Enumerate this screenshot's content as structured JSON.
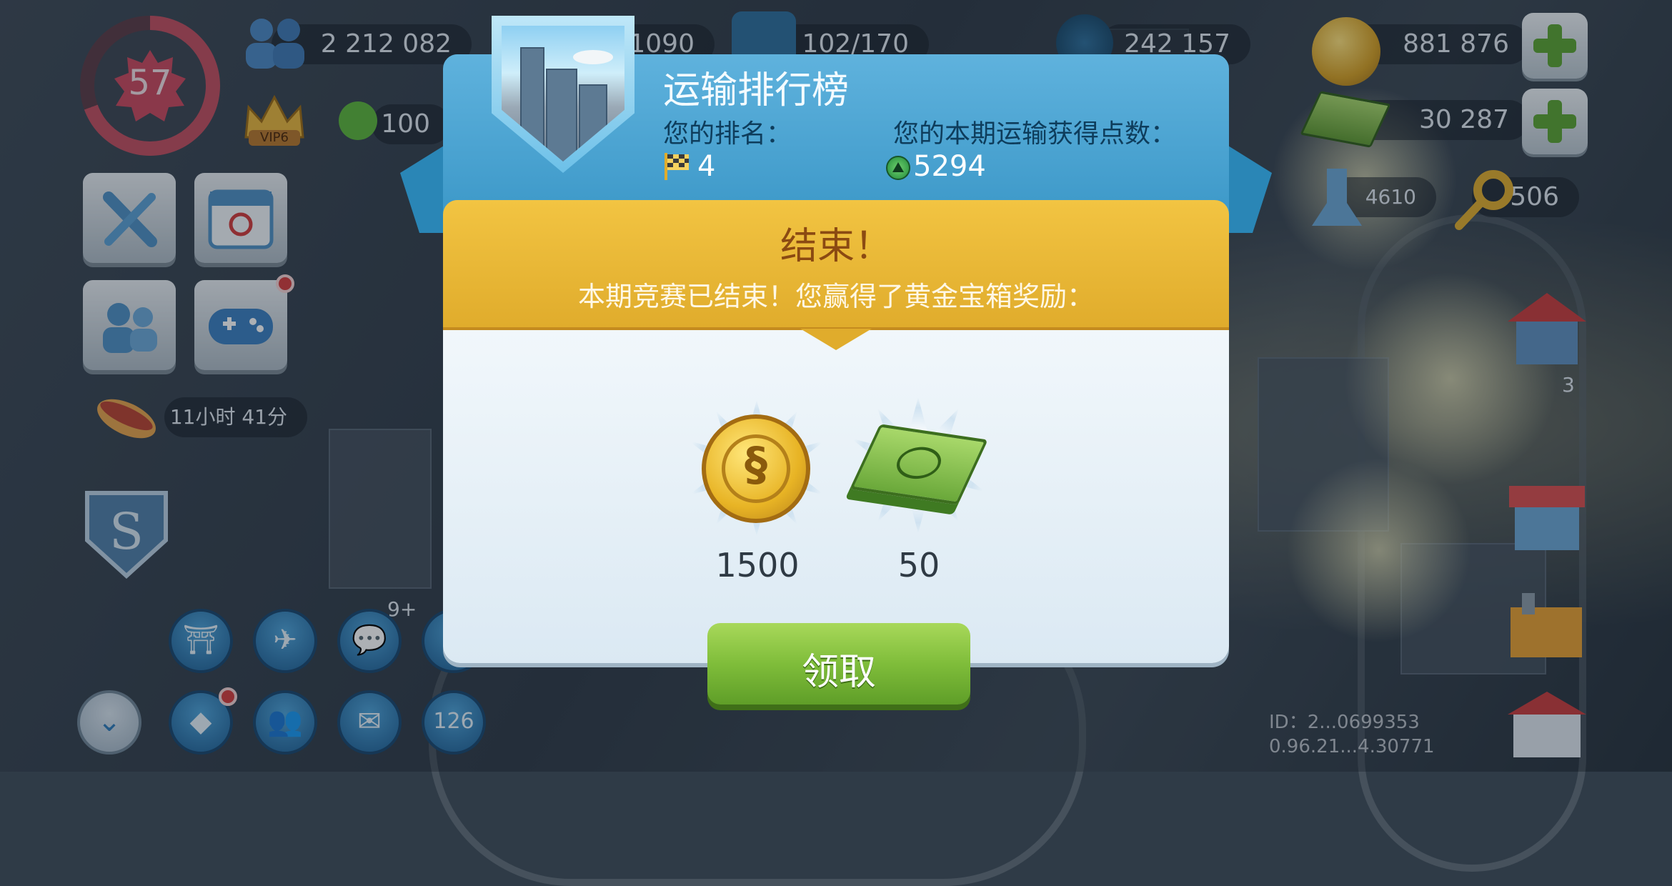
{
  "hud": {
    "level": "57",
    "population": "2 212 082",
    "happiness": "100",
    "currency_mid": "1090",
    "storage": "102/170",
    "neo_simoleons": "242 157",
    "simoleons": "881 876",
    "simcash": "30 287",
    "war_currency": "4610",
    "golden_keys": "506",
    "vip_label": "VIP6",
    "event_timer": "11小时 41分",
    "chat_badge": "9+",
    "calendar_day": "126",
    "building_badge": "3"
  },
  "modal": {
    "title": "运输排行榜",
    "rank_label": "您的排名：",
    "rank_value": "4",
    "points_label": "您的本期运输获得点数：",
    "points_value": "5294",
    "end_title": "结束！",
    "end_message": "本期竞赛已结束！您赢得了黄金宝箱奖励：",
    "rewards": [
      {
        "icon": "simoleon-coin-icon",
        "amount": "1500"
      },
      {
        "icon": "simcash-bill-icon",
        "amount": "50"
      }
    ],
    "claim_label": "领取"
  },
  "footer": {
    "id_text": "ID：2...0699353",
    "version": "0.96.21...4.30771"
  },
  "colors": {
    "header_blue": "#4aa6d4",
    "banner_gold": "#e8b632",
    "claim_green": "#7fbd3a",
    "body_panel": "#e7f1f8"
  }
}
